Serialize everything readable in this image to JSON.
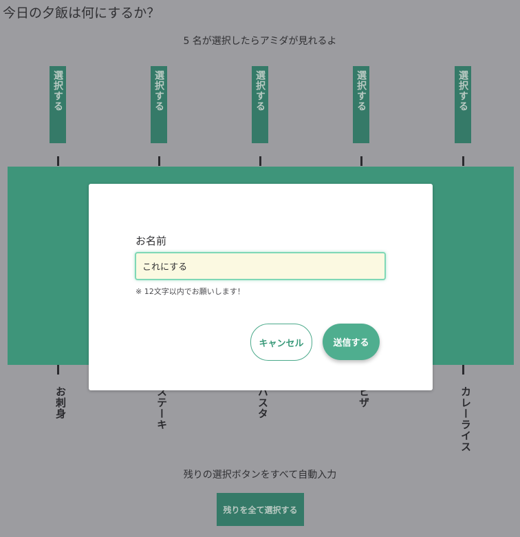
{
  "page": {
    "title": "今日の夕飯は何にするか？",
    "info": "5 名が選択したらアミダが見れるよ"
  },
  "select_buttons": [
    {
      "label": "選択する"
    },
    {
      "label": "選択する"
    },
    {
      "label": "選択する"
    },
    {
      "label": "選択する"
    },
    {
      "label": "選択する"
    }
  ],
  "results": [
    {
      "label": "お刺身"
    },
    {
      "label": "ステーキ"
    },
    {
      "label": "パスタ"
    },
    {
      "label": "ピザ"
    },
    {
      "label": "カレーライス"
    }
  ],
  "auto_fill": {
    "text": "残りの選択ボタンをすべて自動入力",
    "button_label": "残りを全て選択する"
  },
  "modal": {
    "label": "お名前",
    "input_value": "これにする",
    "note": "※ 12文字以内でお願いします！",
    "cancel_label": "キャンセル",
    "submit_label": "送信する"
  },
  "colors": {
    "background": "#9c9ca0",
    "amida_board": "#3e957a",
    "select_button": "#357a68",
    "accent": "#4fae8f",
    "input_bg": "#fbf9e1"
  }
}
